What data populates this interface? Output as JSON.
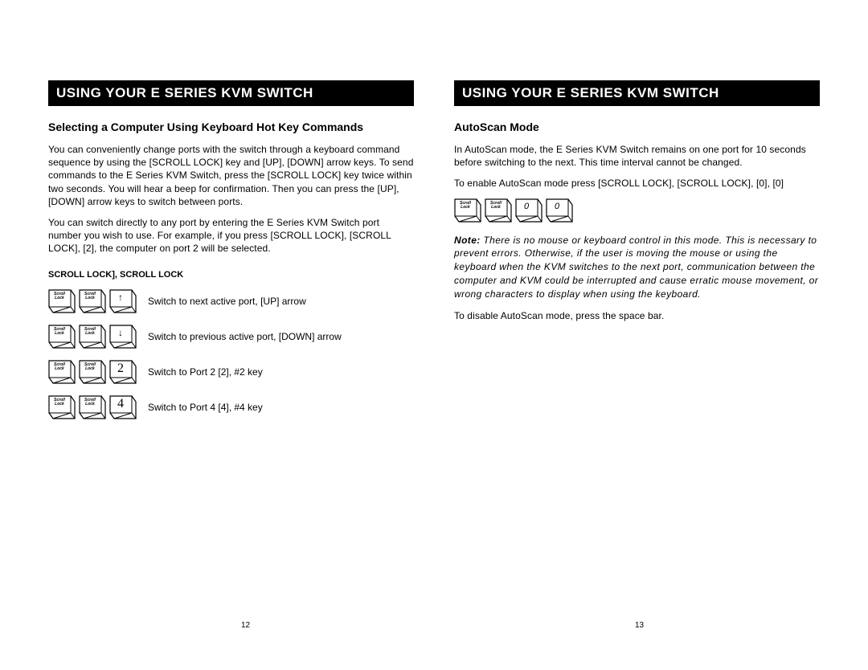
{
  "left": {
    "header": "USING YOUR E SERIES KVM SWITCH",
    "heading": "Selecting a Computer Using Keyboard Hot Key Commands",
    "para1": "You can conveniently change ports with the switch through a keyboard command sequence by using the [SCROLL LOCK] key and [UP], [DOWN] arrow keys. To send commands to the E Series KVM Switch, press the [SCROLL LOCK] key twice within two seconds. You will hear a beep for confirmation. Then you can press the [UP], [DOWN] arrow keys to switch between ports.",
    "para2": "You can switch directly to any port by entering the E Series KVM Switch port number you wish to use. For example, if you press [SCROLL LOCK], [SCROLL LOCK], [2], the computer on port 2 will be selected.",
    "sublabel": "SCROLL LOCK], SCROLL LOCK",
    "rows": [
      {
        "keys": [
          "scroll",
          "scroll",
          "up"
        ],
        "desc": "Switch to next active port, [UP] arrow"
      },
      {
        "keys": [
          "scroll",
          "scroll",
          "down"
        ],
        "desc": "Switch to previous active port, [DOWN] arrow"
      },
      {
        "keys": [
          "scroll",
          "scroll",
          "2"
        ],
        "desc": "Switch to Port 2  [2], #2 key"
      },
      {
        "keys": [
          "scroll",
          "scroll",
          "4"
        ],
        "desc": "Switch to Port 4  [4], #4 key"
      }
    ],
    "pagenum": "12"
  },
  "right": {
    "header": "USING YOUR E SERIES KVM SWITCH",
    "heading": "AutoScan Mode",
    "para1": "In AutoScan mode, the E Series KVM Switch remains on one port for 10 seconds before switching to the next. This time interval cannot be changed.",
    "para2": "To enable AutoScan mode press [SCROLL LOCK], [SCROLL LOCK], [0], [0]",
    "keys": [
      "scroll",
      "scroll",
      "0",
      "0"
    ],
    "note_label": "Note:",
    "note": " There is no mouse or keyboard control in this mode. This is necessary to prevent errors. Otherwise, if the user is moving the mouse or using the keyboard when the KVM switches to the next port, communication between the computer and KVM could be interrupted and cause erratic mouse movement, or wrong characters to display when using the keyboard.",
    "para3": "To disable AutoScan mode, press the space bar.",
    "pagenum": "13"
  },
  "keylabels": {
    "scroll": "Scroll<br>Lock",
    "up": "↑",
    "down": "↓",
    "2": "2",
    "4": "4",
    "0": "0"
  }
}
